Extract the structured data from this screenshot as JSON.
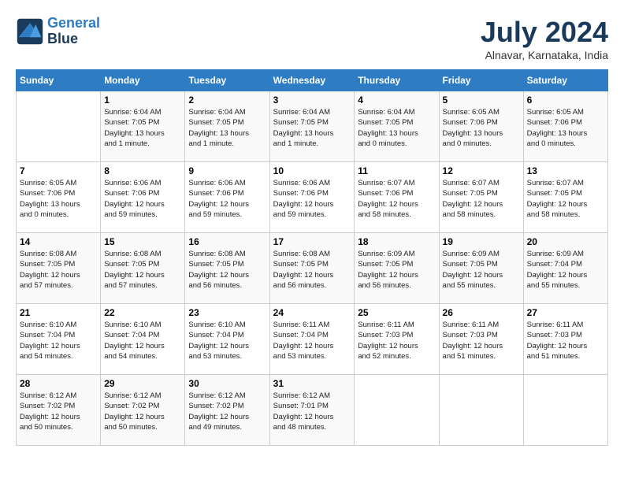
{
  "header": {
    "logo_line1": "General",
    "logo_line2": "Blue",
    "month": "July 2024",
    "location": "Alnavar, Karnataka, India"
  },
  "columns": [
    "Sunday",
    "Monday",
    "Tuesday",
    "Wednesday",
    "Thursday",
    "Friday",
    "Saturday"
  ],
  "weeks": [
    [
      {
        "day": "",
        "text": ""
      },
      {
        "day": "1",
        "text": "Sunrise: 6:04 AM\nSunset: 7:05 PM\nDaylight: 13 hours\nand 1 minute."
      },
      {
        "day": "2",
        "text": "Sunrise: 6:04 AM\nSunset: 7:05 PM\nDaylight: 13 hours\nand 1 minute."
      },
      {
        "day": "3",
        "text": "Sunrise: 6:04 AM\nSunset: 7:05 PM\nDaylight: 13 hours\nand 1 minute."
      },
      {
        "day": "4",
        "text": "Sunrise: 6:04 AM\nSunset: 7:05 PM\nDaylight: 13 hours\nand 0 minutes."
      },
      {
        "day": "5",
        "text": "Sunrise: 6:05 AM\nSunset: 7:06 PM\nDaylight: 13 hours\nand 0 minutes."
      },
      {
        "day": "6",
        "text": "Sunrise: 6:05 AM\nSunset: 7:06 PM\nDaylight: 13 hours\nand 0 minutes."
      }
    ],
    [
      {
        "day": "7",
        "text": "Sunrise: 6:05 AM\nSunset: 7:06 PM\nDaylight: 13 hours\nand 0 minutes."
      },
      {
        "day": "8",
        "text": "Sunrise: 6:06 AM\nSunset: 7:06 PM\nDaylight: 12 hours\nand 59 minutes."
      },
      {
        "day": "9",
        "text": "Sunrise: 6:06 AM\nSunset: 7:06 PM\nDaylight: 12 hours\nand 59 minutes."
      },
      {
        "day": "10",
        "text": "Sunrise: 6:06 AM\nSunset: 7:06 PM\nDaylight: 12 hours\nand 59 minutes."
      },
      {
        "day": "11",
        "text": "Sunrise: 6:07 AM\nSunset: 7:06 PM\nDaylight: 12 hours\nand 58 minutes."
      },
      {
        "day": "12",
        "text": "Sunrise: 6:07 AM\nSunset: 7:05 PM\nDaylight: 12 hours\nand 58 minutes."
      },
      {
        "day": "13",
        "text": "Sunrise: 6:07 AM\nSunset: 7:05 PM\nDaylight: 12 hours\nand 58 minutes."
      }
    ],
    [
      {
        "day": "14",
        "text": "Sunrise: 6:08 AM\nSunset: 7:05 PM\nDaylight: 12 hours\nand 57 minutes."
      },
      {
        "day": "15",
        "text": "Sunrise: 6:08 AM\nSunset: 7:05 PM\nDaylight: 12 hours\nand 57 minutes."
      },
      {
        "day": "16",
        "text": "Sunrise: 6:08 AM\nSunset: 7:05 PM\nDaylight: 12 hours\nand 56 minutes."
      },
      {
        "day": "17",
        "text": "Sunrise: 6:08 AM\nSunset: 7:05 PM\nDaylight: 12 hours\nand 56 minutes."
      },
      {
        "day": "18",
        "text": "Sunrise: 6:09 AM\nSunset: 7:05 PM\nDaylight: 12 hours\nand 56 minutes."
      },
      {
        "day": "19",
        "text": "Sunrise: 6:09 AM\nSunset: 7:05 PM\nDaylight: 12 hours\nand 55 minutes."
      },
      {
        "day": "20",
        "text": "Sunrise: 6:09 AM\nSunset: 7:04 PM\nDaylight: 12 hours\nand 55 minutes."
      }
    ],
    [
      {
        "day": "21",
        "text": "Sunrise: 6:10 AM\nSunset: 7:04 PM\nDaylight: 12 hours\nand 54 minutes."
      },
      {
        "day": "22",
        "text": "Sunrise: 6:10 AM\nSunset: 7:04 PM\nDaylight: 12 hours\nand 54 minutes."
      },
      {
        "day": "23",
        "text": "Sunrise: 6:10 AM\nSunset: 7:04 PM\nDaylight: 12 hours\nand 53 minutes."
      },
      {
        "day": "24",
        "text": "Sunrise: 6:11 AM\nSunset: 7:04 PM\nDaylight: 12 hours\nand 53 minutes."
      },
      {
        "day": "25",
        "text": "Sunrise: 6:11 AM\nSunset: 7:03 PM\nDaylight: 12 hours\nand 52 minutes."
      },
      {
        "day": "26",
        "text": "Sunrise: 6:11 AM\nSunset: 7:03 PM\nDaylight: 12 hours\nand 51 minutes."
      },
      {
        "day": "27",
        "text": "Sunrise: 6:11 AM\nSunset: 7:03 PM\nDaylight: 12 hours\nand 51 minutes."
      }
    ],
    [
      {
        "day": "28",
        "text": "Sunrise: 6:12 AM\nSunset: 7:02 PM\nDaylight: 12 hours\nand 50 minutes."
      },
      {
        "day": "29",
        "text": "Sunrise: 6:12 AM\nSunset: 7:02 PM\nDaylight: 12 hours\nand 50 minutes."
      },
      {
        "day": "30",
        "text": "Sunrise: 6:12 AM\nSunset: 7:02 PM\nDaylight: 12 hours\nand 49 minutes."
      },
      {
        "day": "31",
        "text": "Sunrise: 6:12 AM\nSunset: 7:01 PM\nDaylight: 12 hours\nand 48 minutes."
      },
      {
        "day": "",
        "text": ""
      },
      {
        "day": "",
        "text": ""
      },
      {
        "day": "",
        "text": ""
      }
    ]
  ]
}
